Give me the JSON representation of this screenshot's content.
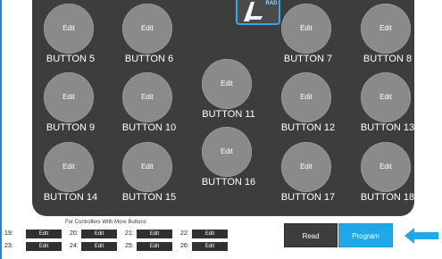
{
  "logo": {
    "text": "RAD"
  },
  "buttons": [
    {
      "edit_label": "Edit",
      "name": "BUTTON 5"
    },
    {
      "edit_label": "Edit",
      "name": "BUTTON 6"
    },
    {
      "edit_label": "Edit",
      "name": "BUTTON 7"
    },
    {
      "edit_label": "Edit",
      "name": "BUTTON 8"
    },
    {
      "edit_label": "Edit",
      "name": "BUTTON 9"
    },
    {
      "edit_label": "Edit",
      "name": "BUTTON 10"
    },
    {
      "edit_label": "Edit",
      "name": "BUTTON 11"
    },
    {
      "edit_label": "Edit",
      "name": "BUTTON 12"
    },
    {
      "edit_label": "Edit",
      "name": "BUTTON 13"
    },
    {
      "edit_label": "Edit",
      "name": "BUTTON 14"
    },
    {
      "edit_label": "Edit",
      "name": "BUTTON 15"
    },
    {
      "edit_label": "Edit",
      "name": "BUTTON 16"
    },
    {
      "edit_label": "Edit",
      "name": "BUTTON 17"
    },
    {
      "edit_label": "Edit",
      "name": "BUTTON 18"
    }
  ],
  "extra_buttons": {
    "caption": "For Controllers With More Buttons",
    "items": [
      {
        "label": "19:",
        "edit_label": "Edit"
      },
      {
        "label": "20:",
        "edit_label": "Edit"
      },
      {
        "label": "21:",
        "edit_label": "Edit"
      },
      {
        "label": "22:",
        "edit_label": "Edit"
      },
      {
        "label": "23:",
        "edit_label": "Edit"
      },
      {
        "label": "24:",
        "edit_label": "Edit"
      },
      {
        "label": "25:",
        "edit_label": "Edit"
      },
      {
        "label": "26:",
        "edit_label": "Edit"
      }
    ]
  },
  "actions": {
    "read_label": "Read",
    "program_label": "Program"
  },
  "icons": {
    "arrow": "left-arrow-icon",
    "logo": "controller-logo-icon"
  },
  "colors": {
    "panel": "#3d3d3d",
    "circle_button": "#8a8a8a",
    "accent": "#1fa8e8",
    "dark_button": "#303030"
  }
}
